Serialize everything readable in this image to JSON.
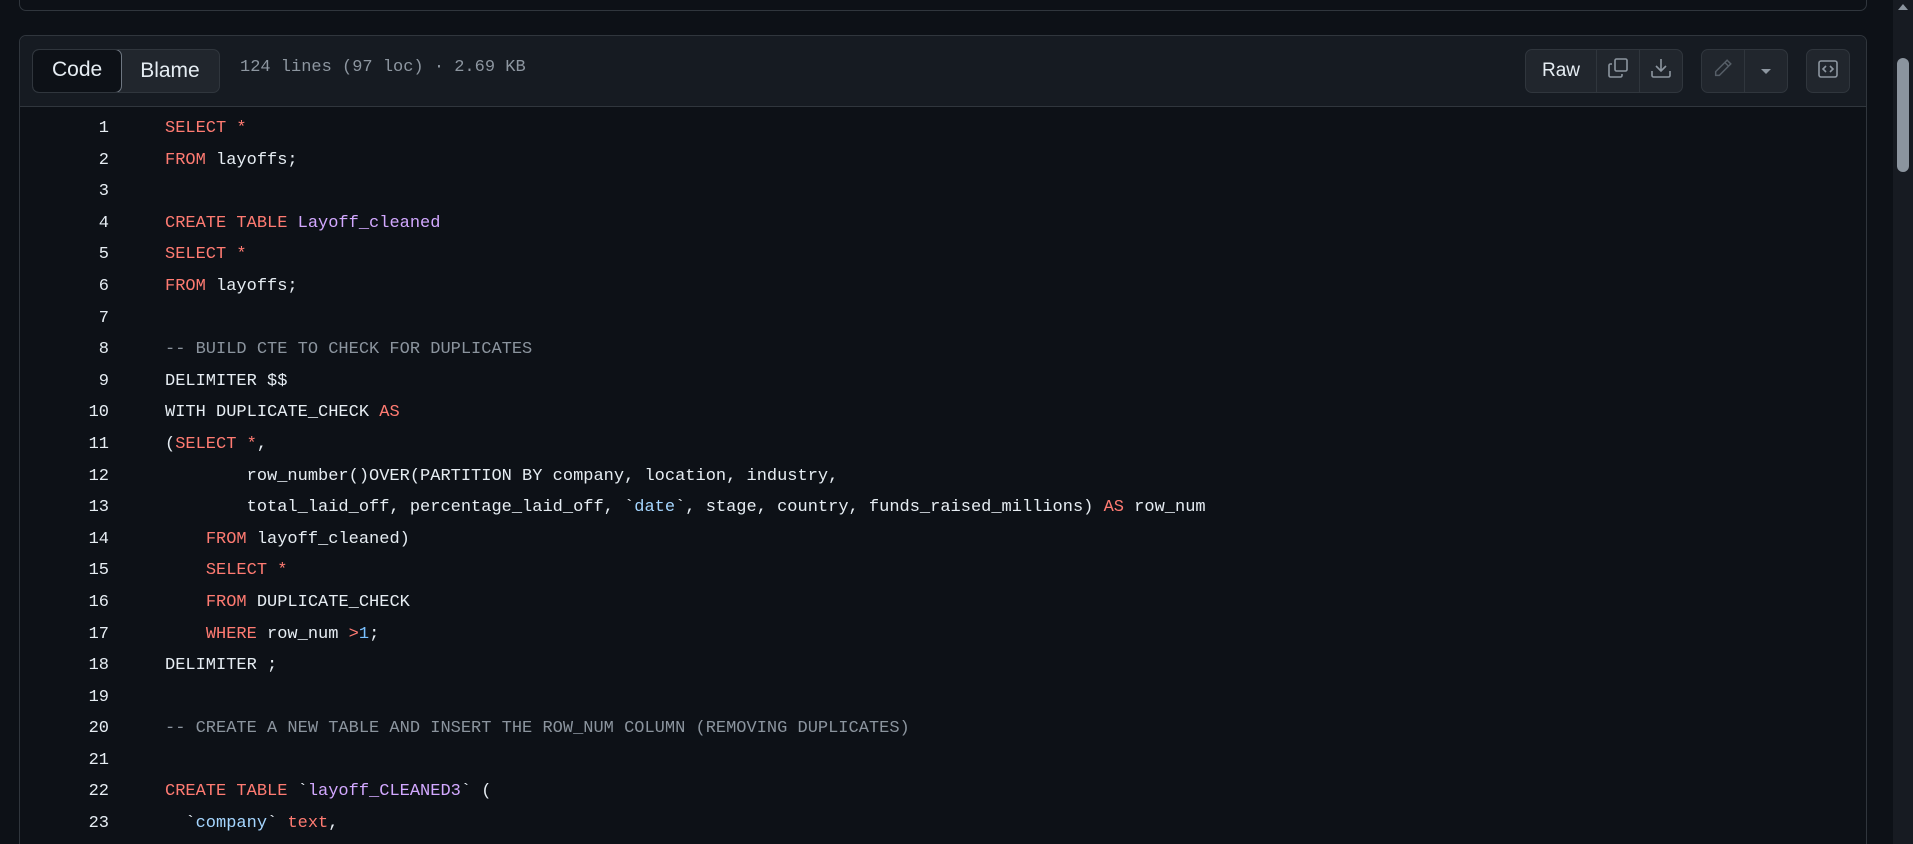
{
  "file_header": {
    "tabs": [
      {
        "label": "Code",
        "active": true
      },
      {
        "label": "Blame",
        "active": false
      }
    ],
    "file_info": "124 lines (97 loc) · 2.69 KB",
    "raw_label": "Raw",
    "icons": {
      "copy": "copy-icon",
      "download": "download-icon",
      "edit": "pencil-icon",
      "dropdown": "chevron-down-icon",
      "symbols": "code-square-icon"
    }
  },
  "colors": {
    "background": "#0d1117",
    "header": "#161b22",
    "border": "#30363d",
    "keyword": "#ff7b72",
    "entity": "#d2a8ff",
    "comment": "#8b949e",
    "constant": "#79c0ff"
  },
  "code_lines": [
    {
      "n": "1",
      "tokens": [
        {
          "t": "SELECT *",
          "c": "kw"
        }
      ]
    },
    {
      "n": "2",
      "tokens": [
        {
          "t": "FROM",
          "c": "kw"
        },
        {
          "t": " layoffs;",
          "c": ""
        }
      ]
    },
    {
      "n": "3",
      "tokens": []
    },
    {
      "n": "4",
      "tokens": [
        {
          "t": "CREATE TABLE",
          "c": "kw"
        },
        {
          "t": " ",
          "c": ""
        },
        {
          "t": "Layoff_cleaned",
          "c": "fn"
        }
      ]
    },
    {
      "n": "5",
      "tokens": [
        {
          "t": "SELECT *",
          "c": "kw"
        }
      ]
    },
    {
      "n": "6",
      "tokens": [
        {
          "t": "FROM",
          "c": "kw"
        },
        {
          "t": " layoffs;",
          "c": ""
        }
      ]
    },
    {
      "n": "7",
      "tokens": []
    },
    {
      "n": "8",
      "tokens": [
        {
          "t": "-- BUILD CTE TO CHECK FOR DUPLICATES",
          "c": "cm"
        }
      ]
    },
    {
      "n": "9",
      "tokens": [
        {
          "t": "DELIMITER $$",
          "c": ""
        }
      ]
    },
    {
      "n": "10",
      "tokens": [
        {
          "t": "WITH DUPLICATE_CHECK ",
          "c": ""
        },
        {
          "t": "AS",
          "c": "kw"
        }
      ]
    },
    {
      "n": "11",
      "tokens": [
        {
          "t": "(",
          "c": ""
        },
        {
          "t": "SELECT *",
          "c": "kw"
        },
        {
          "t": ",",
          "c": ""
        }
      ]
    },
    {
      "n": "12",
      "tokens": [
        {
          "t": "        row_number()OVER(PARTITION BY company, location, industry,",
          "c": ""
        }
      ]
    },
    {
      "n": "13",
      "tokens": [
        {
          "t": "        total_laid_off, percentage_laid_off, `",
          "c": ""
        },
        {
          "t": "date",
          "c": "st"
        },
        {
          "t": "`, stage, country, funds_raised_millions) ",
          "c": ""
        },
        {
          "t": "AS",
          "c": "kw"
        },
        {
          "t": " row_num",
          "c": ""
        }
      ]
    },
    {
      "n": "14",
      "tokens": [
        {
          "t": "    ",
          "c": ""
        },
        {
          "t": "FROM",
          "c": "kw"
        },
        {
          "t": " layoff_cleaned)",
          "c": ""
        }
      ]
    },
    {
      "n": "15",
      "tokens": [
        {
          "t": "    ",
          "c": ""
        },
        {
          "t": "SELECT *",
          "c": "kw"
        }
      ]
    },
    {
      "n": "16",
      "tokens": [
        {
          "t": "    ",
          "c": ""
        },
        {
          "t": "FROM",
          "c": "kw"
        },
        {
          "t": " DUPLICATE_CHECK",
          "c": ""
        }
      ]
    },
    {
      "n": "17",
      "tokens": [
        {
          "t": "    ",
          "c": ""
        },
        {
          "t": "WHERE",
          "c": "kw"
        },
        {
          "t": " row_num ",
          "c": ""
        },
        {
          "t": ">",
          "c": "kw"
        },
        {
          "t": "1",
          "c": "nm"
        },
        {
          "t": ";",
          "c": ""
        }
      ]
    },
    {
      "n": "18",
      "tokens": [
        {
          "t": "DELIMITER ;",
          "c": ""
        }
      ]
    },
    {
      "n": "19",
      "tokens": []
    },
    {
      "n": "20",
      "tokens": [
        {
          "t": "-- CREATE A NEW TABLE AND INSERT THE ROW_NUM COLUMN (REMOVING DUPLICATES)",
          "c": "cm"
        }
      ]
    },
    {
      "n": "21",
      "tokens": []
    },
    {
      "n": "22",
      "tokens": [
        {
          "t": "CREATE TABLE",
          "c": "kw"
        },
        {
          "t": " `",
          "c": ""
        },
        {
          "t": "layoff_CLEANED3",
          "c": "fn"
        },
        {
          "t": "` (",
          "c": ""
        }
      ]
    },
    {
      "n": "23",
      "tokens": [
        {
          "t": "  `",
          "c": ""
        },
        {
          "t": "company",
          "c": "st"
        },
        {
          "t": "` ",
          "c": ""
        },
        {
          "t": "text",
          "c": "kw"
        },
        {
          "t": ",",
          "c": ""
        }
      ]
    }
  ]
}
